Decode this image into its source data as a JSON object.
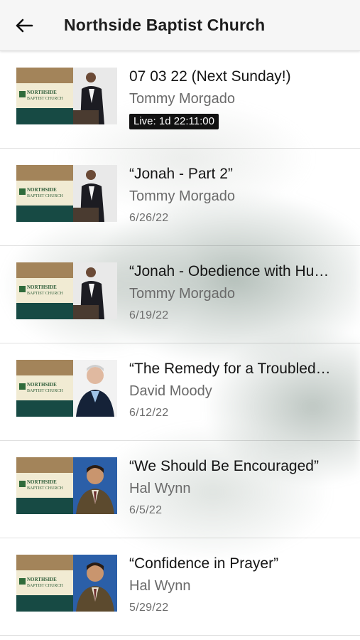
{
  "header": {
    "title": "Northside Baptist Church",
    "back_icon": "arrow-left-icon"
  },
  "sermons": [
    {
      "title": "07 03 22 (Next Sunday!)",
      "speaker": "Tommy Morgado",
      "date": "",
      "live_badge": "Live: 1d 22:11:00",
      "photo": "young-man-at-podium"
    },
    {
      "title": "“Jonah - Part 2”",
      "speaker": "Tommy Morgado",
      "date": "6/26/22",
      "live_badge": "",
      "photo": "young-man-at-podium"
    },
    {
      "title": "“Jonah - Obedience with Hu…",
      "speaker": "Tommy Morgado",
      "date": "6/19/22",
      "live_badge": "",
      "photo": "young-man-at-podium"
    },
    {
      "title": "“The Remedy for a Troubled…",
      "speaker": "David Moody",
      "date": "6/12/22",
      "live_badge": "",
      "photo": "older-man-portrait"
    },
    {
      "title": "“We Should Be Encouraged”",
      "speaker": "Hal Wynn",
      "date": "6/5/22",
      "live_badge": "",
      "photo": "man-on-blue-portrait"
    },
    {
      "title": "“Confidence in Prayer”",
      "speaker": "Hal Wynn",
      "date": "5/29/22",
      "live_badge": "",
      "photo": "man-on-blue-portrait"
    }
  ],
  "colors": {
    "logo_brown": "#a3845a",
    "logo_cream": "#f1ebd3",
    "logo_green": "#174a44",
    "badge_bg": "#111111"
  }
}
